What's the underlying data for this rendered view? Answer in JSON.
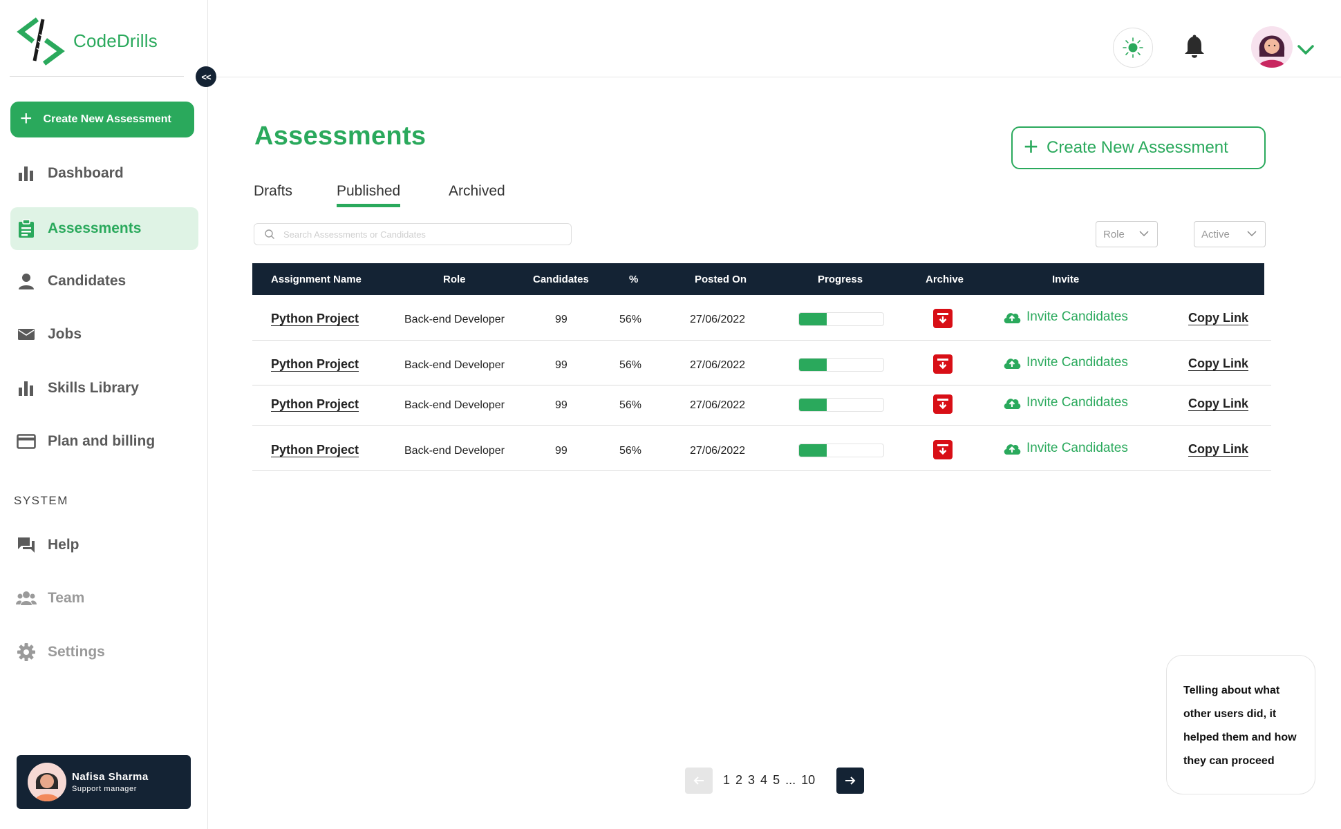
{
  "app": {
    "name": "CodeDrills"
  },
  "sidebar": {
    "collapse_label": "<<",
    "create_button": {
      "label": "Create New Assessment",
      "icon": "plus-icon"
    },
    "items": [
      {
        "label": "Dashboard",
        "icon": "bar-chart-icon",
        "active": false
      },
      {
        "label": "Assessments",
        "icon": "clipboard-icon",
        "active": true
      },
      {
        "label": "Candidates",
        "icon": "person-icon",
        "active": false
      },
      {
        "label": "Jobs",
        "icon": "mail-icon",
        "active": false
      },
      {
        "label": "Skills Library",
        "icon": "bar-chart-icon",
        "active": false
      },
      {
        "label": "Plan and billing",
        "icon": "credit-card-icon",
        "active": false
      }
    ],
    "system_label": "SYSTEM",
    "system_items": [
      {
        "label": "Help",
        "icon": "chat-bubbles-icon"
      },
      {
        "label": "Team",
        "icon": "group-icon"
      },
      {
        "label": "Settings",
        "icon": "gear-icon"
      }
    ],
    "profile": {
      "name": "Nafisa Sharma",
      "role": "Support manager"
    }
  },
  "header": {
    "theme_icon": "sun-icon",
    "notification_icon": "bell-icon",
    "user_menu_icon": "chevron-down-icon"
  },
  "main": {
    "title": "Assessments",
    "create_button": "Create New Assessment",
    "tabs": [
      {
        "label": "Drafts",
        "active": false
      },
      {
        "label": "Published",
        "active": true
      },
      {
        "label": "Archived",
        "active": false
      }
    ],
    "search": {
      "placeholder": "Search Assessments or Candidates",
      "value": ""
    },
    "filters": {
      "role": "Role",
      "status": "Active"
    },
    "table": {
      "columns": [
        "Assignment Name",
        "Role",
        "Candidates",
        "%",
        "Posted On",
        "Progress",
        "Archive",
        "Invite"
      ],
      "rows": [
        {
          "name": "Python Project",
          "role": "Back-end Developer",
          "candidates": "99",
          "percent": "56%",
          "posted_on": "27/06/2022",
          "progress": 0.33,
          "invite": "Invite Candidates",
          "copy": "Copy Link"
        },
        {
          "name": "Python Project",
          "role": "Back-end Developer",
          "candidates": "99",
          "percent": "56%",
          "posted_on": "27/06/2022",
          "progress": 0.33,
          "invite": "Invite Candidates",
          "copy": "Copy Link"
        },
        {
          "name": "Python Project",
          "role": "Back-end Developer",
          "candidates": "99",
          "percent": "56%",
          "posted_on": "27/06/2022",
          "progress": 0.33,
          "invite": "Invite Candidates",
          "copy": "Copy Link"
        },
        {
          "name": "Python Project",
          "role": "Back-end Developer",
          "candidates": "99",
          "percent": "56%",
          "posted_on": "27/06/2022",
          "progress": 0.33,
          "invite": "Invite Candidates",
          "copy": "Copy Link"
        }
      ]
    },
    "pagination": {
      "pages": [
        "1",
        "2",
        "3",
        "4",
        "5",
        "...",
        "10"
      ]
    }
  },
  "tip": {
    "text": "Telling about what other users did, it helped them and how they can proceed"
  },
  "colors": {
    "brand": "#2aa95c",
    "dark": "#142334",
    "archive": "#d80f16",
    "active_bg": "#dff3e5"
  }
}
